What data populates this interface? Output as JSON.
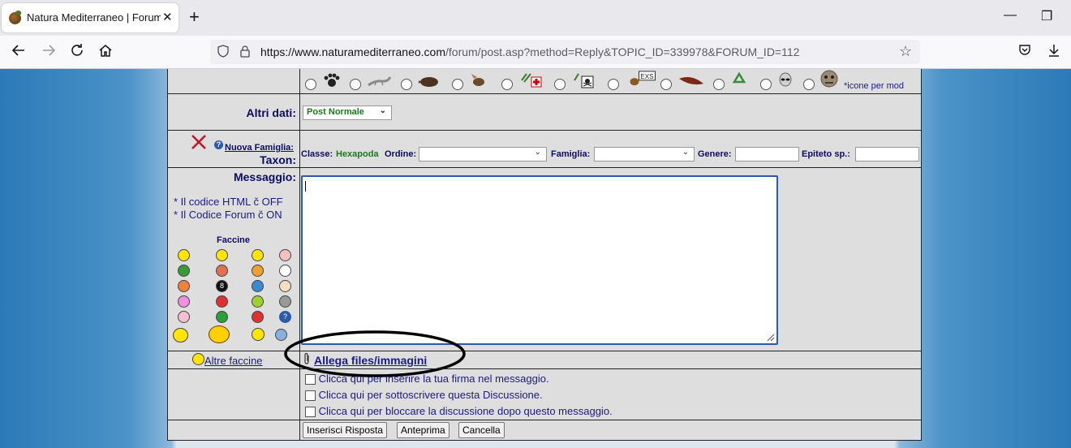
{
  "browser": {
    "tab_title": "Natura Mediterraneo | Forum N",
    "tab_close": "✕",
    "new_tab": "+",
    "minimize": "—",
    "restore": "❐",
    "url_host": "https://www.naturamediterraneo.com",
    "url_path": "/forum/post.asp?method=Reply&TOPIC_ID=339978&FORUM_ID=112"
  },
  "icons_row": {
    "mod_note": "*icone per mod"
  },
  "altri_dati": {
    "label": "Altri dati:",
    "select_value": "Post Normale"
  },
  "taxon": {
    "nuova_famiglia": "Nuova Famiglia:",
    "label": "Taxon:",
    "classe_label": "Classe:",
    "classe_value": "Hexapoda",
    "ordine_label": "Ordine:",
    "famiglia_label": "Famiglia:",
    "genere_label": "Genere:",
    "epiteto_label": "Epiteto sp.:"
  },
  "messaggio": {
    "label": "Messaggio:",
    "html_note": "* Il codice HTML č OFF",
    "forum_note": "* Il Codice Forum č ON",
    "faccine_title": "Faccine",
    "altre_faccine": "Altre faccine",
    "allega": "Allega files/immagini"
  },
  "options": {
    "firma": "Clicca qui per inserire la tua firma nel messaggio.",
    "sottoscrivi": "Clicca qui per sottoscrivere questa Discussione.",
    "blocca": "Clicca qui per bloccare la discussione dopo questo messaggio."
  },
  "buttons": {
    "inserisci": "Inserisci Risposta",
    "anteprima": "Anteprima",
    "cancella": "Cancella"
  },
  "colors": {
    "label_navy": "#0b0b63",
    "green_text": "#1a7a1a",
    "link_blue": "#1a1a8c"
  }
}
